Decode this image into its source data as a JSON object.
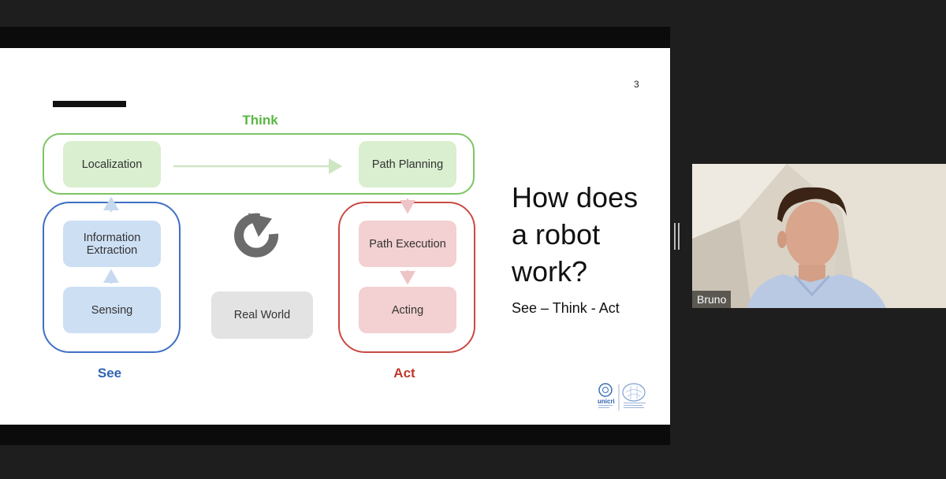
{
  "slide": {
    "number": "3",
    "groups": {
      "think": "Think",
      "see": "See",
      "act": "Act"
    },
    "boxes": {
      "localization": "Localization",
      "path_planning": "Path Planning",
      "information_extraction_line1": "Information",
      "information_extraction_line2": "Extraction",
      "sensing": "Sensing",
      "path_execution": "Path Execution",
      "acting": "Acting",
      "real_world": "Real World"
    },
    "headline_line1": "How does",
    "headline_line2": "a robot",
    "headline_line3": "work?",
    "subtitle": "See – Think - Act",
    "logo": {
      "name": "unicri"
    },
    "colors": {
      "think": "#5ab743",
      "see": "#2f63b3",
      "act": "#c0392b"
    }
  },
  "participant": {
    "name": "Bruno"
  }
}
